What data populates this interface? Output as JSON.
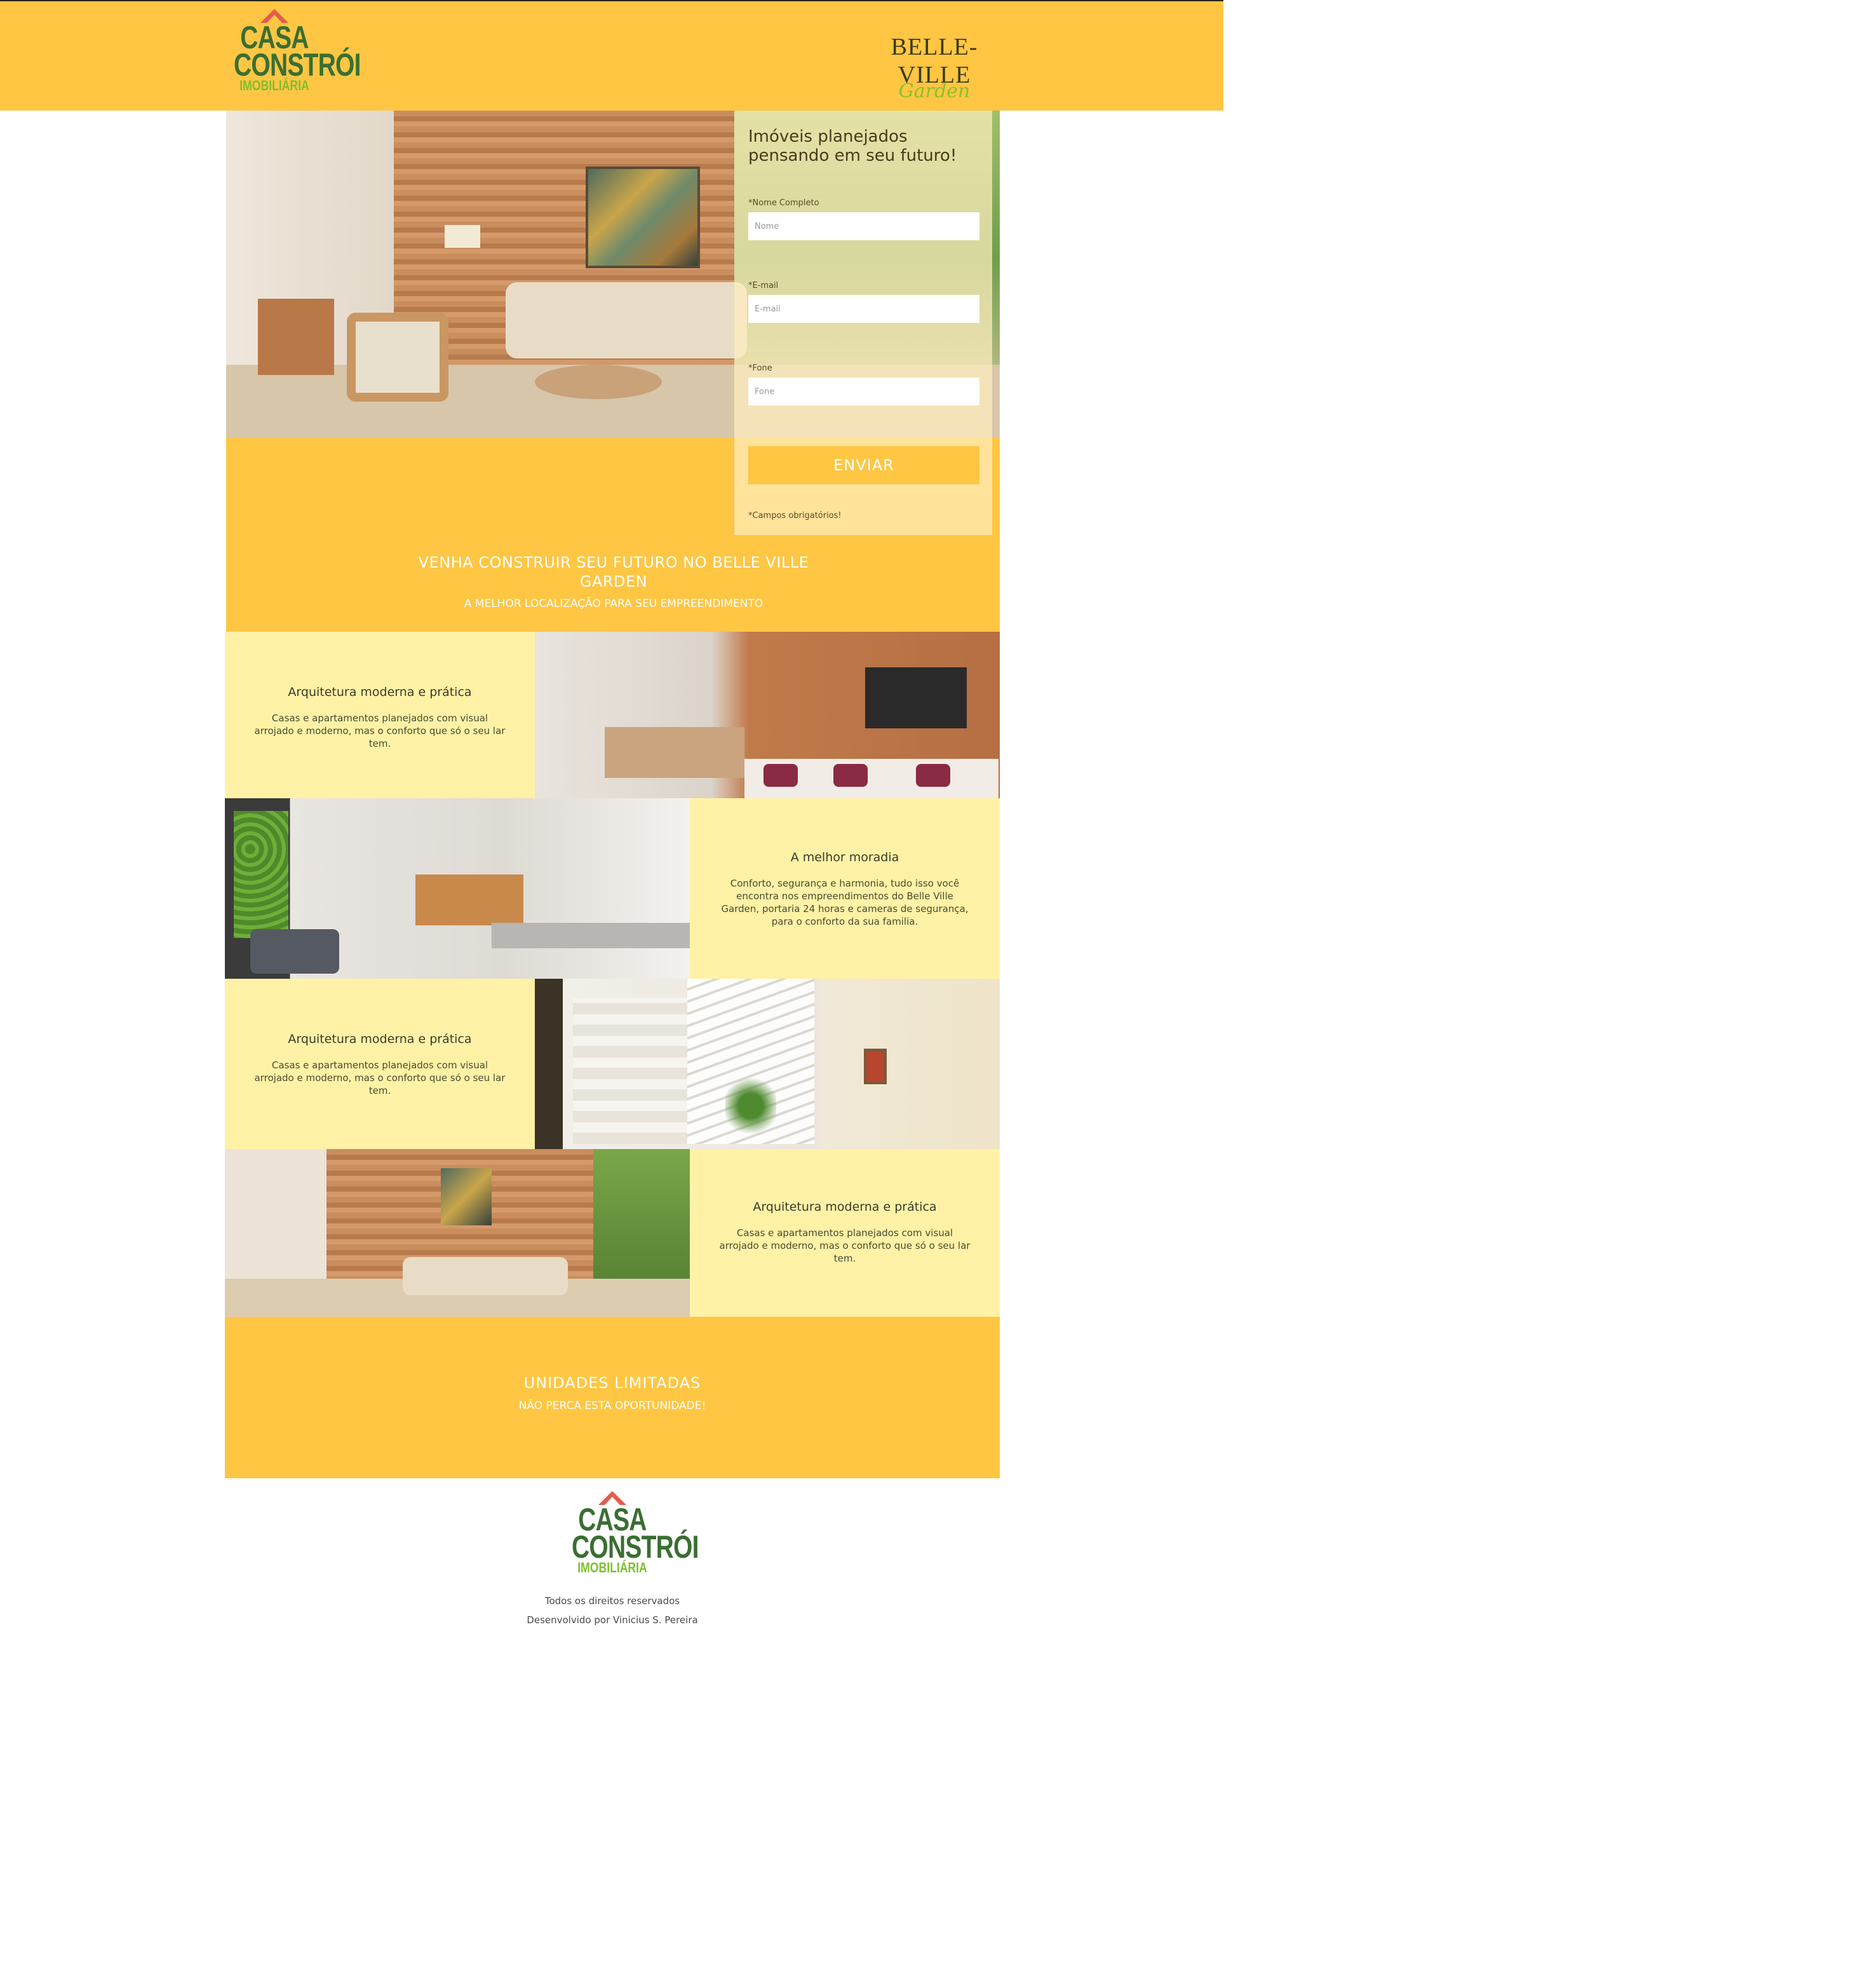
{
  "header": {
    "logo": {
      "line1": "CASA",
      "line2": "CONSTRÓI",
      "line3": "IMOBILIÁRIA"
    },
    "partner_logo": {
      "name": "BELLE-VILLE",
      "script": "Garden"
    }
  },
  "hero_form": {
    "title": "Imóveis planejados pensando em seu futuro!",
    "fields": [
      {
        "label": "*Nome Completo",
        "placeholder": "Nome",
        "value": ""
      },
      {
        "label": "*E-mail",
        "placeholder": "E-mail",
        "value": ""
      },
      {
        "label": "*Fone",
        "placeholder": "Fone",
        "value": ""
      }
    ],
    "submit_label": "ENVIAR",
    "required_note": "*Campos obrigatórios!"
  },
  "intro_band": {
    "title": "VENHA CONSTRUIR SEU FUTURO NO BELLE VILLE GARDEN",
    "subtitle": "A MELHOR LOCALIZAÇÃO PARA SEU EMPREENDIMENTO"
  },
  "features": [
    {
      "title": "Arquitetura moderna e prática",
      "text": "Casas e apartamentos planejados com visual arrojado e moderno, mas o conforto que só o seu lar tem."
    },
    {
      "title": "A melhor moradia",
      "text": "Conforto, segurança e harmonia, tudo isso você encontra nos empreendimentos do Belle Ville Garden, portaria 24 horas e cameras de segurança, para o conforto da sua familia."
    },
    {
      "title": "Arquitetura moderna e prática",
      "text": "Casas e apartamentos planejados com visual arrojado e moderno, mas o conforto que só o seu lar tem."
    },
    {
      "title": "Arquitetura moderna e prática",
      "text": "Casas e apartamentos planejados com visual arrojado e moderno, mas o conforto que só o seu lar tem."
    }
  ],
  "cta_band": {
    "title": "UNIDADES LIMITADAS",
    "subtitle": "NÃO PERCA ESTA OPORTUNIDADE!"
  },
  "footer": {
    "logo": {
      "line1": "CASA",
      "line2": "CONSTRÓI",
      "line3": "IMOBILIÁRIA"
    },
    "rights": "Todos os direitos reservados",
    "credits": "Desenvolvido por Vinicius S. Pereira"
  },
  "colors": {
    "brand_yellow": "#fec643",
    "light_yellow": "#fff2a6",
    "logo_green": "#3a6e32",
    "logo_lime": "#7fbf2e",
    "logo_red": "#e65a4c"
  }
}
